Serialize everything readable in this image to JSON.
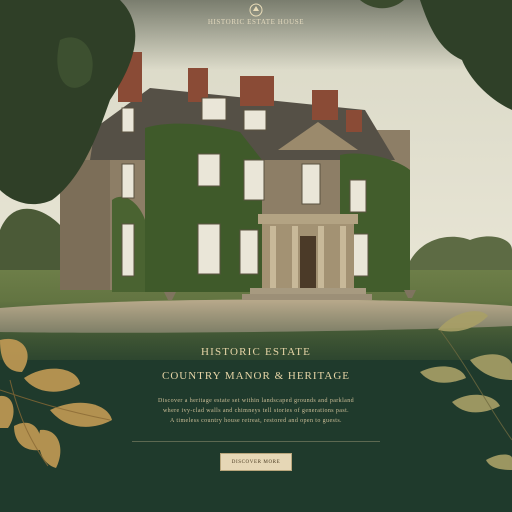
{
  "header": {
    "logo_icon": "crest-icon",
    "nav_text": "HISTORIC ESTATE HOUSE"
  },
  "main": {
    "headline": "HISTORIC ESTATE",
    "subhead": "COUNTRY MANOR & HERITAGE",
    "body_lines": [
      "Discover a heritage estate set within landscaped grounds and parkland",
      "where ivy-clad walls and chimneys tell stories of generations past.",
      "A timeless country house retreat, restored and open to guests."
    ],
    "cta_label": "DISCOVER MORE"
  },
  "colors": {
    "panel_green": "#1f3a2c",
    "gold_text": "#e5d4a6",
    "cta_fill": "#e6d7b6",
    "ivy_green": "#3f5a2a",
    "stone": "#8d7e66"
  },
  "icons": [
    "crest-icon",
    "leaf-icon"
  ]
}
